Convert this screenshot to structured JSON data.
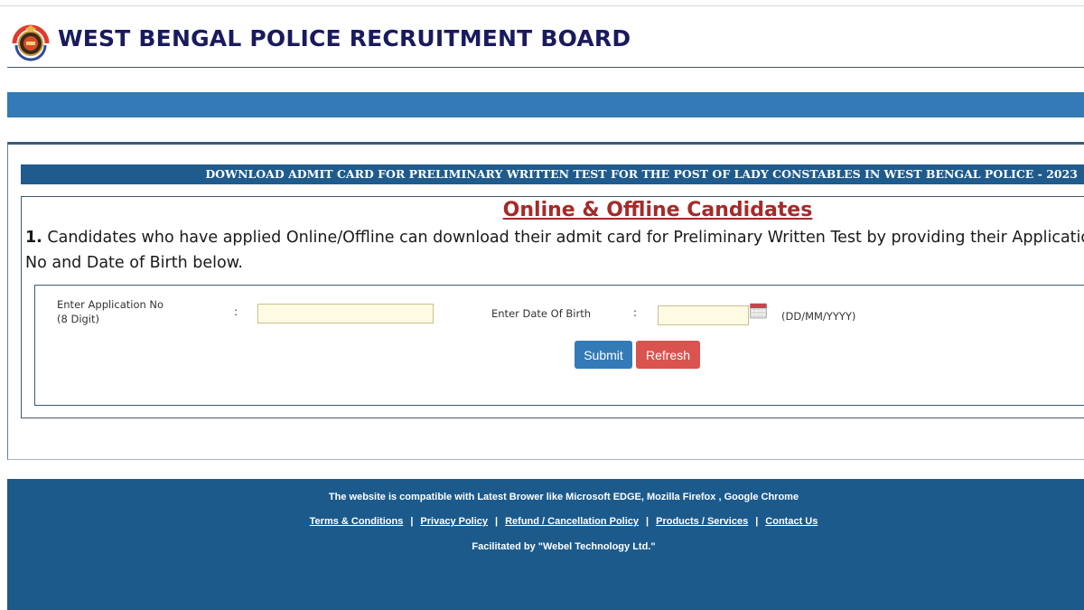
{
  "header": {
    "title": "WEST BENGAL POLICE RECRUITMENT BOARD",
    "logo_icon": "police-emblem-icon"
  },
  "banner": {
    "text": "DOWNLOAD ADMIT CARD FOR PRELIMINARY WRITTEN TEST FOR THE POST OF LADY CONSTABLES IN WEST BENGAL POLICE - 2023"
  },
  "section": {
    "title": "Online & Offline Candidates",
    "instruction_number": "1.",
    "instruction_line1": " Candidates who have applied Online/Offline can download their admit card for Preliminary Written Test by providing their Application",
    "instruction_line2": "No and Date of Birth below."
  },
  "form": {
    "application_label_line1": "Enter Application No",
    "application_label_line2": "(8 Digit)",
    "application_colon": ":",
    "application_value": "",
    "dob_label": "Enter Date Of Birth",
    "dob_colon": ":",
    "dob_value": "",
    "dob_format_hint": "(DD/MM/YYYY)",
    "calendar_icon": "calendar-icon",
    "submit_label": "Submit",
    "refresh_label": "Refresh"
  },
  "footer": {
    "compatibility_text": "The website is compatible with Latest Brower like Microsoft EDGE, Mozilla Firefox , Google Chrome",
    "links": [
      {
        "label": "Terms & Conditions"
      },
      {
        "label": "Privacy Policy"
      },
      {
        "label": "Refund / Cancellation Policy"
      },
      {
        "label": "Products / Services"
      },
      {
        "label": "Contact Us"
      }
    ],
    "separator": "|",
    "facilitated_text": "Facilitated by \"Webel Technology Ltd.\""
  },
  "colors": {
    "nav_bar": "#337ab7",
    "banner": "#1f5b8c",
    "footer": "#1c5a8c",
    "section_title": "#a52a2a",
    "submit_button": "#337ab7",
    "refresh_button": "#d9534f",
    "input_background": "#fffbe3",
    "site_title": "#1a1a5e"
  }
}
